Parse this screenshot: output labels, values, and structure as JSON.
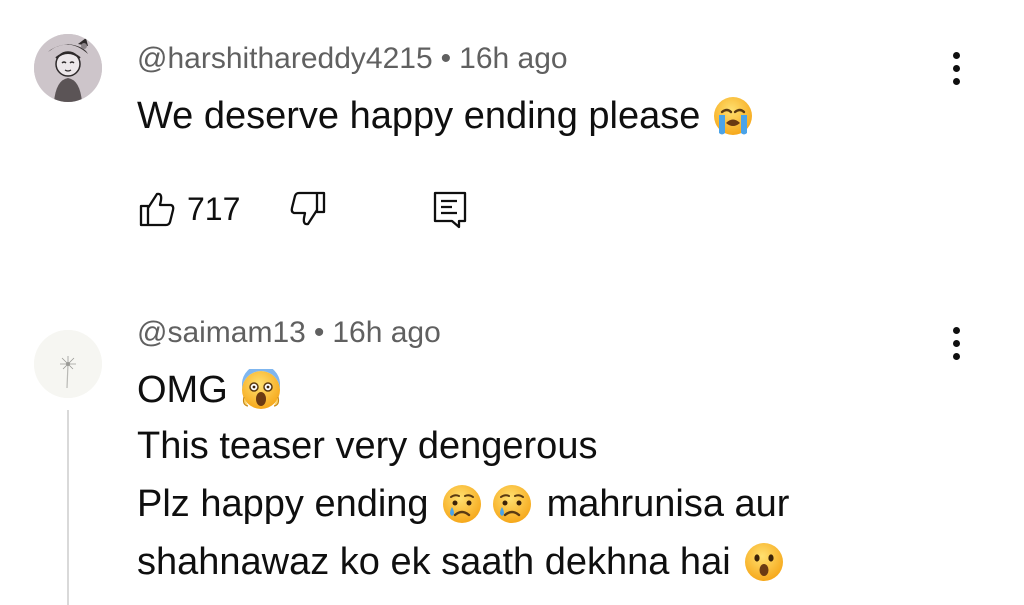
{
  "comments": [
    {
      "author": "@harshithareddy4215",
      "time": "16h ago",
      "separator": "•",
      "lines": [
        "We deserve happy ending please"
      ],
      "likes": "717",
      "emoji": [
        "loudly-crying-face"
      ]
    },
    {
      "author": "@saimam13",
      "time": "16h ago",
      "separator": "•",
      "lines": [
        "OMG",
        "This teaser very dengerous",
        "Plz happy ending",
        "mahrunisa aur",
        "shahnawaz ko ek saath dekhna hai"
      ],
      "emoji": [
        "face-screaming-in-fear",
        "crying-face",
        "crying-face",
        "hushed-face"
      ]
    }
  ],
  "colors": {
    "text": "#0f0f0f",
    "meta": "#606060",
    "emoji_yellow": "#fbbf24",
    "tear_blue": "#4aa3e8",
    "thread_line": "#d9d9d9"
  },
  "icons": [
    "like-icon",
    "dislike-icon",
    "reply-icon",
    "more-vert-icon"
  ]
}
